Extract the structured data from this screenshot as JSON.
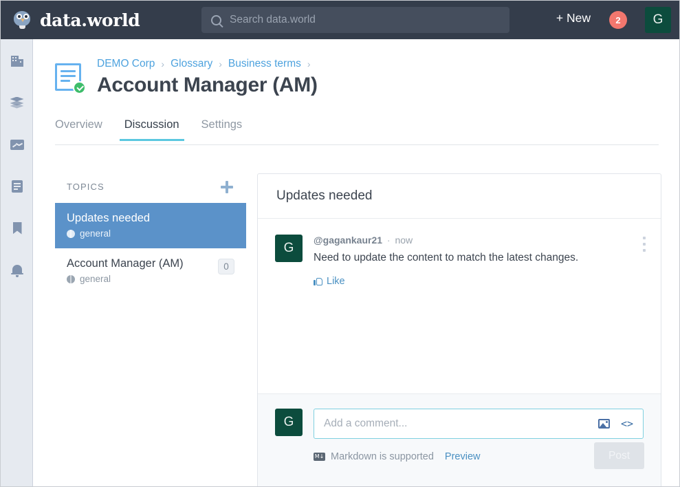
{
  "header": {
    "brand": "data.world",
    "brand_icon": "owl-logo-icon",
    "search": {
      "icon": "search-icon",
      "value": "",
      "placeholder": "Search data.world"
    },
    "new_button": "+ New",
    "notification_count": "2",
    "avatar_initial": "G",
    "background_color": "#343d4b"
  },
  "rail": {
    "items": [
      {
        "icon": "building-icon",
        "name": "organizations"
      },
      {
        "icon": "layers-icon",
        "name": "datasets"
      },
      {
        "icon": "chart-icon",
        "name": "analytics"
      },
      {
        "icon": "document-icon",
        "name": "documents"
      },
      {
        "icon": "bookmark-icon",
        "name": "bookmarks"
      },
      {
        "icon": "bell-icon",
        "name": "notifications"
      }
    ]
  },
  "page": {
    "entity_icon": "glossary-term-verified-icon",
    "breadcrumb": [
      "DEMO Corp",
      "Glossary",
      "Business terms"
    ],
    "breadcrumb_separator": "›",
    "title": "Account Manager (AM)"
  },
  "tabs": [
    {
      "label": "Overview",
      "active": false
    },
    {
      "label": "Discussion",
      "active": true
    },
    {
      "label": "Settings",
      "active": false
    }
  ],
  "topics": {
    "header": "TOPICS",
    "add_icon": "plus-icon",
    "items": [
      {
        "name": "Updates needed",
        "scope": "general",
        "scope_icon": "globe-icon",
        "count": "",
        "selected": true
      },
      {
        "name": "Account Manager (AM)",
        "scope": "general",
        "scope_icon": "globe-icon",
        "count": "0",
        "selected": false
      }
    ]
  },
  "discussion": {
    "title": "Updates needed",
    "comment": {
      "avatar_initial": "G",
      "username": "@gagankaur21",
      "separator": "·",
      "time": "now",
      "text": "Need to update the content to match the latest changes.",
      "like_label": "Like",
      "like_icon": "thumbs-up-icon",
      "menu_icon": "kebab-menu-icon"
    },
    "composer": {
      "avatar_initial": "G",
      "value": "",
      "placeholder": "Add a comment...",
      "image_icon": "image-icon",
      "code_icon": "code-icon",
      "markdown_icon": "markdown-icon",
      "markdown_note": "Markdown is supported",
      "preview_label": "Preview",
      "post_label": "Post"
    }
  },
  "colors": {
    "accent_blue": "#4da2de",
    "selected_topic": "#5b92c9",
    "tab_underline": "#5bc8e0",
    "avatar_green": "#0c4c3d",
    "badge_red": "#f2776e",
    "verified_green": "#3ebd6b"
  }
}
